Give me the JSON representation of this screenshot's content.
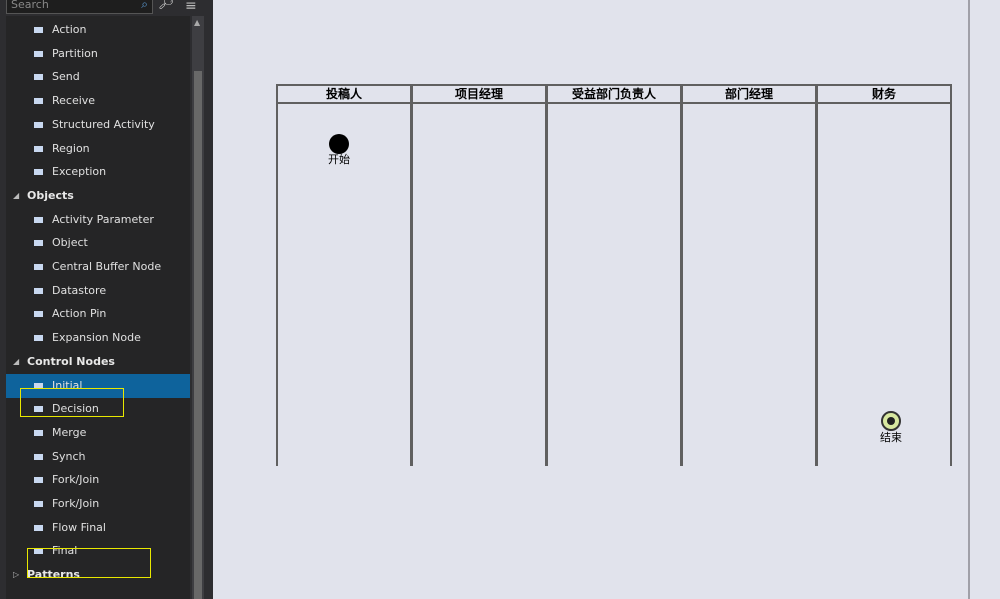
{
  "toolbox": {
    "search_placeholder": "Search",
    "items": [
      {
        "label": "Action",
        "icon": "action-icon"
      },
      {
        "label": "Partition",
        "icon": "partition-icon"
      },
      {
        "label": "Send",
        "icon": "send-icon"
      },
      {
        "label": "Receive",
        "icon": "receive-icon"
      },
      {
        "label": "Structured Activity",
        "icon": "structured-activity-icon"
      },
      {
        "label": "Region",
        "icon": "region-icon"
      },
      {
        "label": "Exception",
        "icon": "exception-icon"
      },
      {
        "label": "Objects",
        "category": true,
        "expanded": true
      },
      {
        "label": "Activity Parameter",
        "icon": "activity-parameter-icon"
      },
      {
        "label": "Object",
        "icon": "object-icon"
      },
      {
        "label": "Central Buffer Node",
        "icon": "central-buffer-icon"
      },
      {
        "label": "Datastore",
        "icon": "datastore-icon"
      },
      {
        "label": "Action Pin",
        "icon": "action-pin-icon"
      },
      {
        "label": "Expansion Node",
        "icon": "expansion-node-icon"
      },
      {
        "label": "Control Nodes",
        "category": true,
        "expanded": true
      },
      {
        "label": "Initial",
        "icon": "initial-icon",
        "selected": true
      },
      {
        "label": "Decision",
        "icon": "decision-icon"
      },
      {
        "label": "Merge",
        "icon": "merge-icon"
      },
      {
        "label": "Synch",
        "icon": "synch-icon"
      },
      {
        "label": "Fork/Join",
        "icon": "fork-horizontal-icon"
      },
      {
        "label": "Fork/Join",
        "icon": "fork-vertical-icon"
      },
      {
        "label": "Flow Final",
        "icon": "flow-final-icon"
      },
      {
        "label": "Final",
        "icon": "final-icon"
      },
      {
        "label": "Patterns",
        "category": true,
        "expanded": false
      }
    ]
  },
  "diagram": {
    "lanes": [
      "投稿人",
      "项目经理",
      "受益部门负责人",
      "部门经理",
      "财务"
    ],
    "start_label": "开始",
    "end_label": "结束"
  },
  "colors": {
    "selection": "#0e639c",
    "highlight": "#e8e800",
    "end_fill": "#d8e8a0"
  }
}
